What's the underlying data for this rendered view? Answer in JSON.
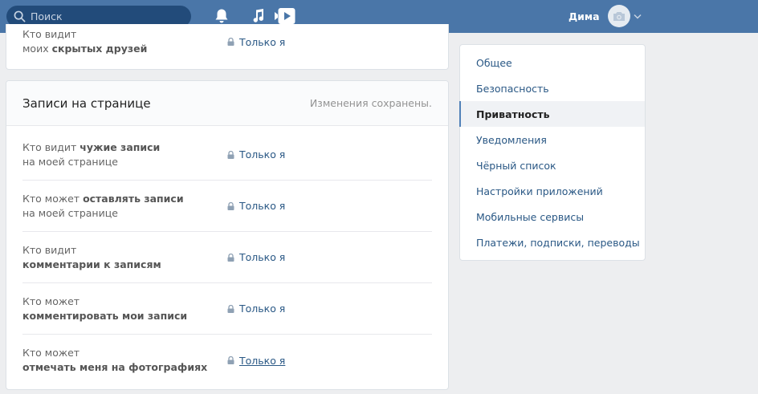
{
  "header": {
    "search_placeholder": "Поиск",
    "user_name": "Дима"
  },
  "top_section": {
    "line1": "Кто видит",
    "line2_prefix": "моих ",
    "line2_bold": "скрытых друзей",
    "value": "Только я"
  },
  "section": {
    "title": "Записи на странице",
    "status": "Изменения сохранены."
  },
  "rows": [
    {
      "line1_prefix": "Кто видит ",
      "line1_bold": "чужие записи",
      "line2_prefix": "на моей странице",
      "line2_bold": "",
      "value": "Только я"
    },
    {
      "line1_prefix": "Кто может ",
      "line1_bold": "оставлять записи",
      "line2_prefix": "на моей странице",
      "line2_bold": "",
      "value": "Только я"
    },
    {
      "line1_prefix": "Кто видит",
      "line1_bold": "",
      "line2_prefix": "",
      "line2_bold": "комментарии к записям",
      "value": "Только я"
    },
    {
      "line1_prefix": "Кто может",
      "line1_bold": "",
      "line2_prefix": "",
      "line2_bold": "комментировать мои записи",
      "value": "Только я"
    },
    {
      "line1_prefix": "Кто может",
      "line1_bold": "",
      "line2_prefix": "",
      "line2_bold": "отмечать меня на фотографиях",
      "value": "Только я"
    }
  ],
  "menu": {
    "items": [
      {
        "label": "Общее"
      },
      {
        "label": "Безопасность"
      },
      {
        "label": "Приватность"
      },
      {
        "label": "Уведомления"
      },
      {
        "label": "Чёрный список"
      },
      {
        "label": "Настройки приложений"
      },
      {
        "label": "Мобильные сервисы"
      },
      {
        "label": "Платежи, подписки, переводы"
      }
    ],
    "active": "Приватность"
  },
  "colors": {
    "header_bg": "#4a76a8",
    "link": "#2a5885",
    "page_bg": "#edeef0"
  },
  "icons": {
    "search": "search-icon",
    "notifications": "bell-icon",
    "music": "music-note-icon",
    "video": "video-play-icon",
    "avatar": "camera-icon",
    "dropdown": "chevron-down-icon",
    "lock": "lock-icon"
  }
}
